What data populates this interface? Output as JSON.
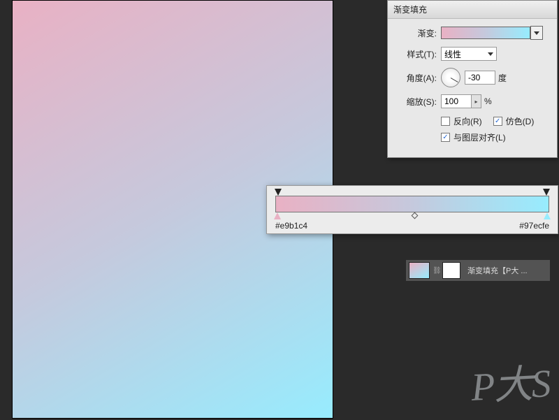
{
  "dialog": {
    "title": "渐变填充",
    "gradient_label": "渐变:",
    "style_label": "样式(T):",
    "style_value": "线性",
    "angle_label": "角度(A):",
    "angle_value": "-30",
    "angle_unit": "度",
    "scale_label": "缩放(S):",
    "scale_value": "100",
    "scale_unit": "%",
    "reverse_label": "反向(R)",
    "reverse_checked": false,
    "dither_label": "仿色(D)",
    "dither_checked": true,
    "align_label": "与图层对齐(L)",
    "align_checked": true
  },
  "gradient_editor": {
    "left_color": "#e9b1c4",
    "right_color": "#97ecfe"
  },
  "layer": {
    "name": "渐变填充【P大 ..."
  },
  "watermark": "P大S",
  "chart_data": {
    "type": "gradient",
    "stops": [
      {
        "position": 0,
        "color": "#e9b1c4"
      },
      {
        "position": 100,
        "color": "#97ecfe"
      }
    ],
    "angle": -30
  }
}
